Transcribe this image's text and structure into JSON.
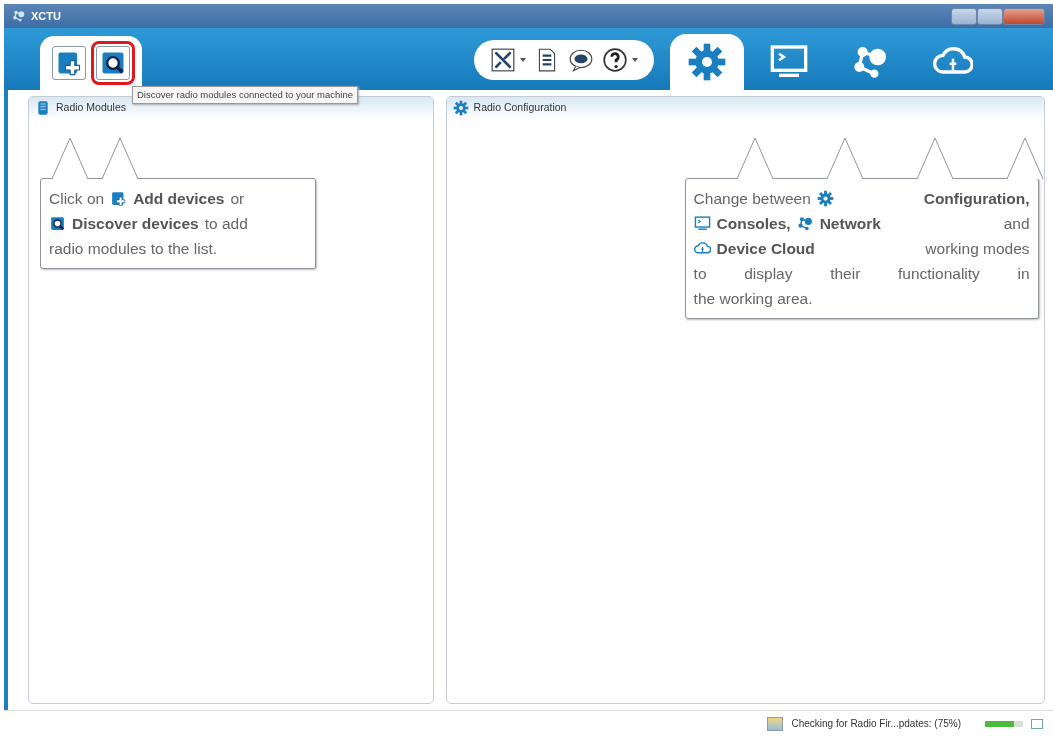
{
  "window": {
    "title": "XCTU"
  },
  "device_tools": [
    {
      "kind": "add",
      "highlighted": false
    },
    {
      "kind": "discover",
      "highlighted": true
    }
  ],
  "tooltip": "Discover radio modules connected to your machine",
  "tool_menu": [
    {
      "kind": "tools",
      "dropdown": true
    },
    {
      "kind": "list",
      "dropdown": false
    },
    {
      "kind": "chat",
      "dropdown": false
    },
    {
      "kind": "help",
      "dropdown": true
    }
  ],
  "modes": [
    {
      "kind": "gear",
      "selected": true
    },
    {
      "kind": "monitor",
      "selected": false
    },
    {
      "kind": "network",
      "selected": false
    },
    {
      "kind": "cloud",
      "selected": false
    }
  ],
  "panels": [
    {
      "title": "Radio Modules",
      "kind": "modules",
      "callout": {
        "lines": [
          [
            {
              "kind": "plain",
              "text": "Click on"
            },
            {
              "kind": "add"
            },
            {
              "kind": "strong",
              "text": "Add devices"
            },
            {
              "kind": "plain",
              "text": "or"
            }
          ],
          [
            {
              "kind": "discover"
            },
            {
              "kind": "strong",
              "text": "Discover devices"
            },
            {
              "kind": "plain",
              "text": "to add"
            }
          ],
          [
            {
              "kind": "plain",
              "text": "radio modules to the list."
            }
          ]
        ]
      }
    },
    {
      "title": "Radio Configuration",
      "kind": "gear",
      "callout": {
        "lines": [
          [
            {
              "kind": "plain",
              "text": "Change between"
            },
            {
              "kind": "gear"
            },
            {
              "kind": "strong",
              "text": "Configuration,"
            }
          ],
          [
            {
              "kind": "monitor"
            },
            {
              "kind": "strong",
              "text": "Consoles,"
            },
            {
              "kind": "network"
            },
            {
              "kind": "strong",
              "text": "Network"
            },
            {
              "kind": "plain",
              "text": "and"
            }
          ],
          [
            {
              "kind": "cloud"
            },
            {
              "kind": "strong",
              "text": "Device Cloud"
            },
            {
              "kind": "plain",
              "text": "working modes"
            }
          ],
          [
            {
              "kind": "plain",
              "text": "to display their functionality in"
            }
          ],
          [
            {
              "kind": "plain",
              "text": "the working area."
            }
          ]
        ]
      }
    }
  ],
  "status_bar": {
    "text": "Checking for Radio Fir...pdates: (75%)",
    "level": 0.75
  }
}
